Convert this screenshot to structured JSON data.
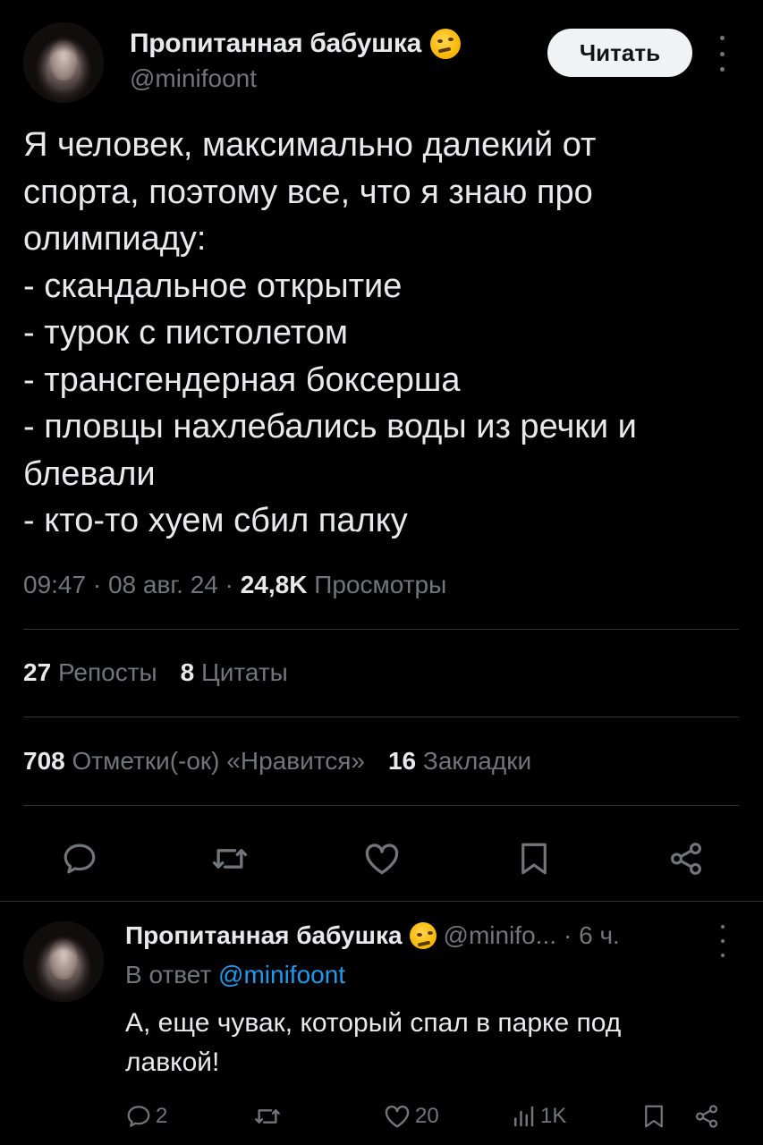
{
  "tweet": {
    "author_name": "Пропитанная бабушка",
    "author_handle": "@minifoont",
    "follow_label": "Читать",
    "text_lines": [
      "Я человек, максимально далекий от",
      "спорта, поэтому все, что я знаю про",
      "олимпиаду:",
      "- скандальное открытие",
      "- турок с пистолетом",
      "- трансгендерная боксерша",
      "- пловцы нахлебались воды из речки и",
      "блевали",
      "- кто-то хуем сбил палку"
    ],
    "time": "09:47",
    "date": "08 авг. 24",
    "views_count": "24,8K",
    "views_label": "Просмотры",
    "reposts_count": "27",
    "reposts_label": "Репосты",
    "quotes_count": "8",
    "quotes_label": "Цитаты",
    "likes_count": "708",
    "likes_label": "Отметки(-ок) «Нравится»",
    "bookmarks_count": "16",
    "bookmarks_label": "Закладки"
  },
  "reply": {
    "author_name": "Пропитанная бабушка",
    "author_handle": "@minifo...",
    "time_ago": "· 6 ч.",
    "reply_to_label": "В ответ",
    "reply_to_handle": "@minifoont",
    "text_lines": [
      "А, еще чувак, который спал в парке под",
      "лавкой!"
    ],
    "replies_count": "2",
    "likes_count": "20",
    "views_count": "1K"
  },
  "icons": {
    "reply": "reply-icon",
    "retweet": "retweet-icon",
    "like": "heart-icon",
    "bookmark": "bookmark-icon",
    "share": "share-icon",
    "views": "views-icon"
  },
  "colors": {
    "background": "#000000",
    "text": "#e7e9ea",
    "muted": "#71767b",
    "link": "#1d9bf0",
    "divider": "#2f3336",
    "button_bg": "#eff3f4"
  }
}
